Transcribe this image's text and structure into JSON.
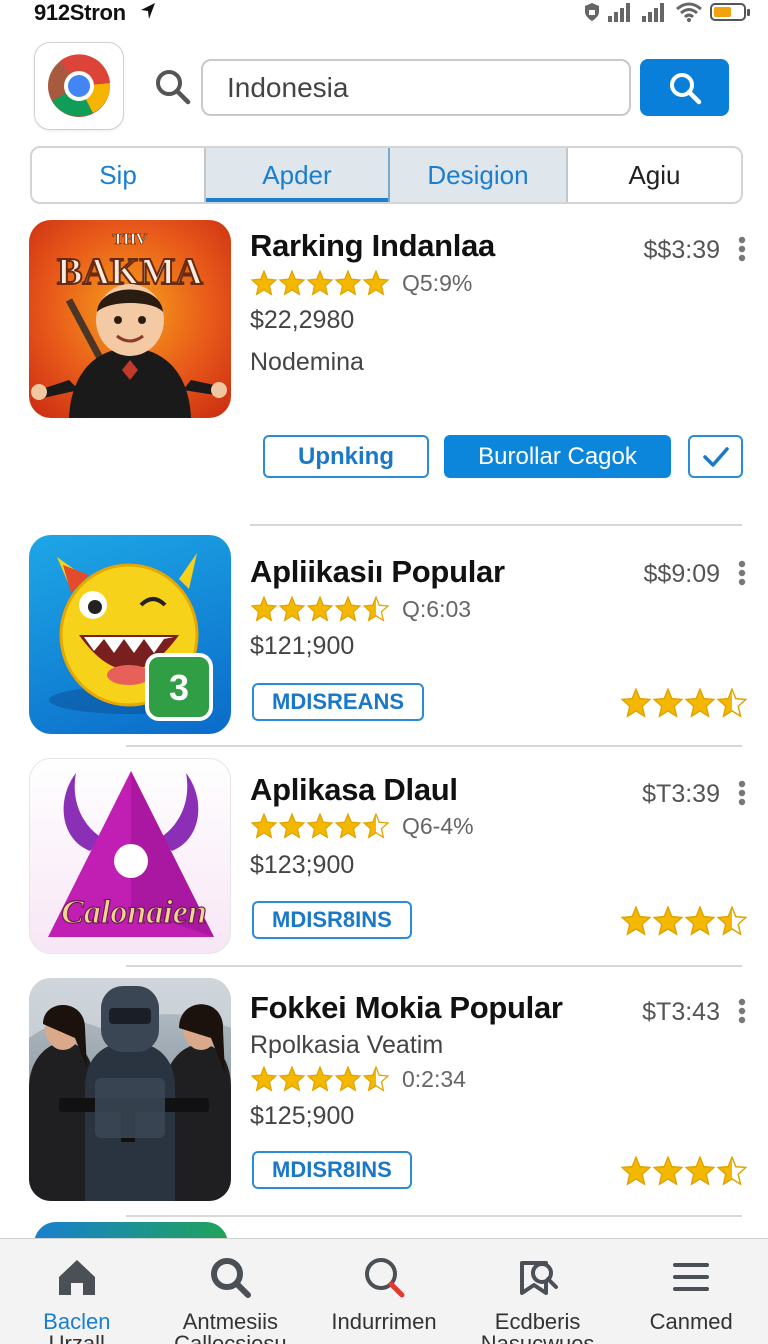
{
  "status_bar": {
    "time": "912Stron",
    "battery_level": 0.6
  },
  "header": {
    "search": {
      "value": "Indonesia",
      "placeholder": ""
    }
  },
  "tabs": [
    "Sip",
    "Apder",
    "Desigion",
    "Agiu"
  ],
  "apps": [
    {
      "title": "Rarking Indanlaa",
      "price": "$$3:39",
      "rating_text": "Q5:9%",
      "stars": 5,
      "amount": "$22,2980",
      "subtitle": "Nodemina",
      "thumb_label": "BAKMA",
      "thumb_prefix": "THV",
      "button_outline": "Upnking",
      "button_solid": "Burollar Cagok"
    },
    {
      "title": "Apliikasiı Popular",
      "price": "$$9:09",
      "rating_text": "Q:6:03",
      "stars": 4.5,
      "amount": "$121;900",
      "tag": "MDISREANS",
      "right_stars": 3.5,
      "thumb_badge": "3"
    },
    {
      "title": "Aplikasa Dlaul",
      "price": "$T3:39",
      "rating_text": "Q6-4%",
      "stars": 4.5,
      "amount": "$123;900",
      "tag": "MDISR8INS",
      "right_stars": 3.5,
      "thumb_label": "Calonaien"
    },
    {
      "title": "Fokkei Mokia Popular",
      "price": "$T3:43",
      "subtitle": "Rpolkasia Veatim",
      "rating_text": "0:2:34",
      "stars": 4.5,
      "amount": "$125;900",
      "tag": "MDISR8INS",
      "right_stars": 3.5
    }
  ],
  "bottom_nav": [
    {
      "label": "Baclen",
      "sub": "Urzall",
      "icon": "home-icon",
      "active": true
    },
    {
      "label": "Antmesiis",
      "sub": "Callecsiesu",
      "icon": "search-icon",
      "active": false
    },
    {
      "label": "Indurrimen",
      "sub": "",
      "icon": "search-red-icon",
      "active": false
    },
    {
      "label": "Ecdberis",
      "sub": "Nasucwues",
      "icon": "bookmark-search-icon",
      "active": false
    },
    {
      "label": "Canmed",
      "sub": "",
      "icon": "menu-icon",
      "active": false
    }
  ],
  "colors": {
    "accent": "#0a7fd9",
    "star": "#f5b800"
  }
}
